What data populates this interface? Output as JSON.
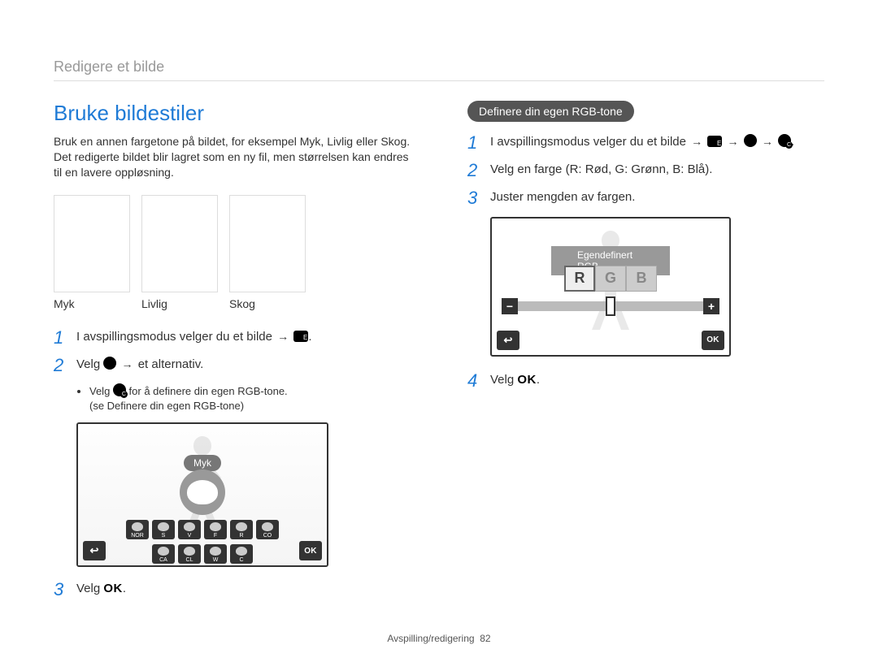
{
  "breadcrumb": "Redigere et bilde",
  "left": {
    "title": "Bruke bildestiler",
    "intro": "Bruk en annen fargetone på bildet, for eksempel Myk, Livlig eller Skog. Det redigerte bildet blir lagret som en ny fil, men størrelsen kan endres til en lavere oppløsning.",
    "thumbs": [
      "Myk",
      "Livlig",
      "Skog"
    ],
    "step1_a": "I avspillingsmodus velger du et bilde ",
    "step2_a": "Velg ",
    "step2_b": " et alternativ.",
    "bullet1_a": "Velg ",
    "bullet1_b": " for å definere din egen RGB-tone.",
    "bullet2": "(se Definere din egen RGB-tone)",
    "step3_a": "Velg ",
    "screen_label": "Myk",
    "mini_row1": [
      "NOR",
      "S",
      "V",
      "F",
      "R",
      "CO"
    ],
    "mini_row2": [
      "CA",
      "CL",
      "W",
      "C"
    ],
    "back_label": "↩",
    "ok_label": "OK"
  },
  "right": {
    "pill": "Definere din egen RGB-tone",
    "step1_a": "I avspillingsmodus velger du et bilde ",
    "step2": "Velg en farge (R: Rød, G: Grønn, B: Blå).",
    "step3": "Juster mengden av fargen.",
    "step4_a": "Velg ",
    "rgb_title": "Egendefinert RGB",
    "rgb_tabs": [
      "R",
      "G",
      "B"
    ],
    "minus": "−",
    "plus": "+",
    "back_label": "↩",
    "ok_label": "OK"
  },
  "footer_section": "Avspilling/redigering",
  "footer_page": "82",
  "arrow_char": "→",
  "ok_glyph": "OK",
  "dot": "."
}
